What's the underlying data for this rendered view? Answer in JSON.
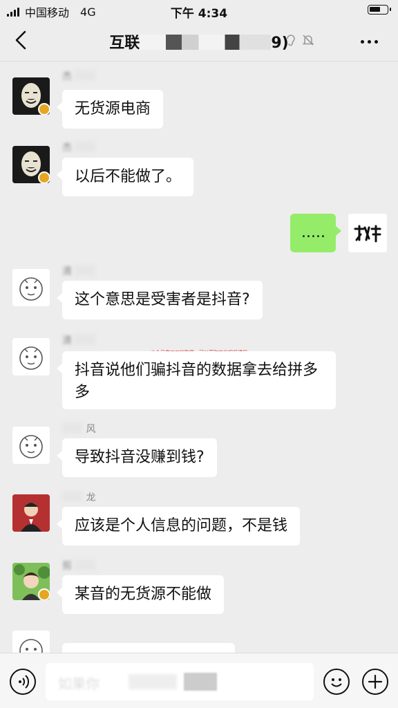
{
  "status_bar": {
    "carrier": "中国移动",
    "network": "4G",
    "time": "下午 4:34"
  },
  "header": {
    "title_prefix": "互联",
    "title_suffix": "9)"
  },
  "messages": [
    {
      "nick": "杰",
      "text": "无货源电商"
    },
    {
      "nick": "杰",
      "text": "以后不能做了。"
    },
    {
      "text": "....."
    },
    {
      "nick": "清",
      "text": "这个意思是受害者是抖音?"
    },
    {
      "nick": "清",
      "text": "抖音说他们骗抖音的数据拿去给拼多多"
    },
    {
      "nick": "风",
      "text": "导致抖音没赚到钱?"
    },
    {
      "nick": "龙",
      "text": "应该是个人信息的问题，不是钱"
    },
    {
      "nick": "剪",
      "text": "某音的无货源不能做"
    }
  ],
  "overlay_text": "公众号拿刀刀的胸罩，可以获取实战视频课程",
  "input": {
    "ghost": "如果你"
  },
  "icons": {
    "back": "chevron-left-icon",
    "mute": "bell-off-icon",
    "more": "ellipsis-icon",
    "voice": "voice-icon",
    "emoji": "emoji-icon",
    "add": "plus-icon"
  }
}
